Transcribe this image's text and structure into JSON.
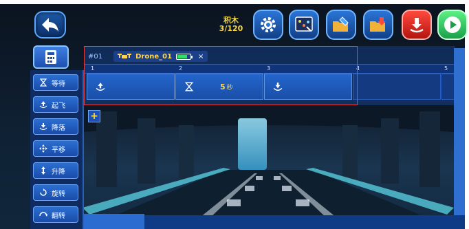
{
  "header": {
    "blocks_label": "积木",
    "blocks_count": "3/120"
  },
  "toolbar": {
    "icons": [
      "back-arrow-icon",
      "gear-icon",
      "drone-map-icon",
      "folder-edit-icon",
      "folder-open-icon",
      "download-icon",
      "play-icon"
    ]
  },
  "sidebar": {
    "items": [
      {
        "label": "等待",
        "icon": "hourglass-icon"
      },
      {
        "label": "起飞",
        "icon": "takeoff-icon"
      },
      {
        "label": "降落",
        "icon": "land-icon"
      },
      {
        "label": "平移",
        "icon": "move-icon"
      },
      {
        "label": "升降",
        "icon": "updown-icon"
      },
      {
        "label": "旋转",
        "icon": "rotate-icon"
      },
      {
        "label": "翻转",
        "icon": "flip-icon"
      }
    ]
  },
  "program": {
    "tab_id": "#01",
    "drone_name": "Drone_01",
    "battery_level": 0.7,
    "close_label": "×",
    "ruler": [
      "1",
      "2",
      "3",
      "4",
      "5"
    ],
    "slots": [
      {
        "icon": "takeoff-icon",
        "value": "",
        "unit": ""
      },
      {
        "icon": "hourglass-icon",
        "value": "5",
        "unit": "秒"
      },
      {
        "icon": "land-icon",
        "value": "",
        "unit": ""
      }
    ]
  },
  "add_label": "+",
  "colors": {
    "accent": "#2b6fd3",
    "highlight": "#ffd64a",
    "battery": "#2ee06a"
  }
}
